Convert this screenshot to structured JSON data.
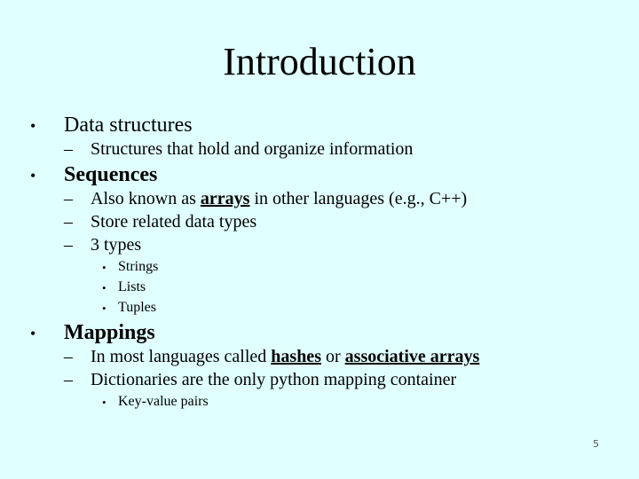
{
  "slide": {
    "title": "Introduction",
    "page_number": "5",
    "items": {
      "data_structures": "Data structures",
      "data_structures_sub": "Structures that hold and organize information",
      "sequences": "Sequences",
      "seq_sub1_a": "Also known as ",
      "seq_sub1_b": "arrays",
      "seq_sub1_c": " in other languages (e.g., C++)",
      "seq_sub2": "Store related data types",
      "seq_sub3": "3 types",
      "types": [
        "Strings",
        "Lists",
        "Tuples"
      ],
      "mappings": "Mappings",
      "map_sub1_a": "In most languages called ",
      "map_sub1_b": "hashes",
      "map_sub1_c": " or ",
      "map_sub1_d": "associative arrays",
      "map_sub2": "Dictionaries are the only python mapping container",
      "map_sub2_child": "Key-value pairs"
    },
    "bullet_glyph": "•",
    "dash_glyph": "–"
  }
}
